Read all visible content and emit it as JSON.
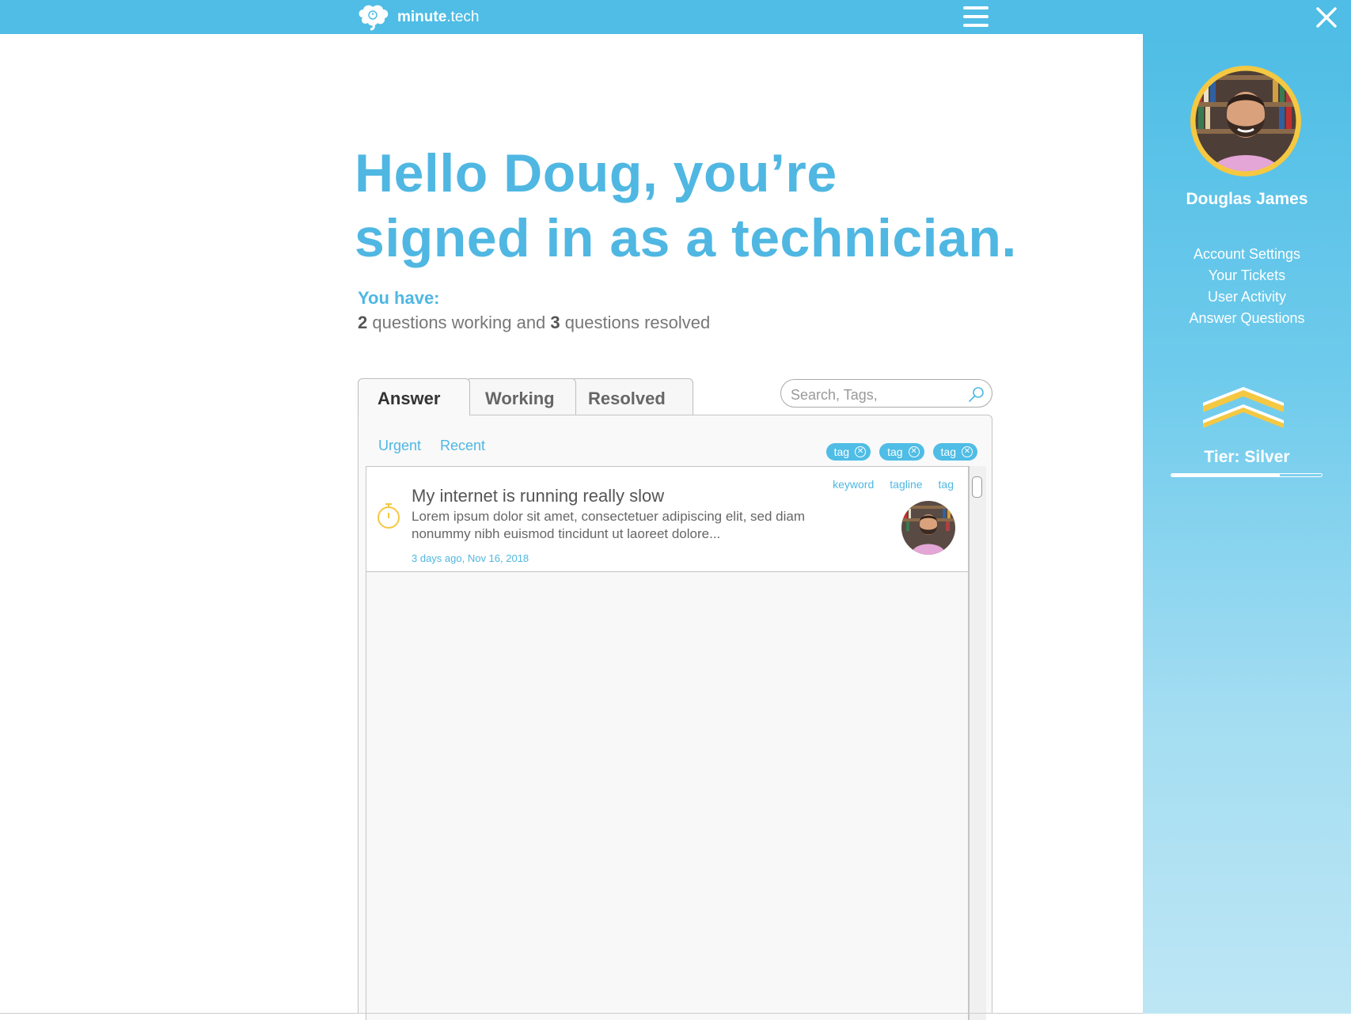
{
  "brand": {
    "name_bold": "minute",
    "name_rest": ".tech"
  },
  "colors": {
    "accent": "#4fbde5",
    "accent_text": "#4fb7e2",
    "gold": "#f5c842"
  },
  "greeting": {
    "line1": "Hello Doug, you’re",
    "line2": "signed in as a technician."
  },
  "summary": {
    "label": "You have:",
    "working_count": "2",
    "working_text": "questions working and",
    "resolved_count": "3",
    "resolved_text": "questions resolved"
  },
  "tabs": [
    {
      "label": "Answer",
      "active": true
    },
    {
      "label": "Working",
      "active": false
    },
    {
      "label": "Resolved",
      "active": false
    }
  ],
  "search": {
    "placeholder": "Search, Tags,"
  },
  "filters": [
    {
      "label": "Urgent"
    },
    {
      "label": "Recent"
    }
  ],
  "chips": [
    {
      "label": "tag"
    },
    {
      "label": "tag"
    },
    {
      "label": "tag"
    }
  ],
  "tickets": [
    {
      "title": "My internet is running really slow",
      "body": "Lorem ipsum dolor sit amet, consectetuer adipiscing elit, sed diam nonummy nibh euismod tincidunt ut laoreet dolore...",
      "date": "3 days ago, Nov 16, 2018",
      "tags": [
        "keyword",
        "tagline",
        "tag"
      ]
    }
  ],
  "profile": {
    "name": "Douglas James",
    "menu": [
      {
        "label": "Account Settings"
      },
      {
        "label": "Your Tickets"
      },
      {
        "label": "User Activity"
      },
      {
        "label": "Answer Questions"
      }
    ],
    "tier": "Tier: Silver",
    "tier_progress": 0.72
  }
}
